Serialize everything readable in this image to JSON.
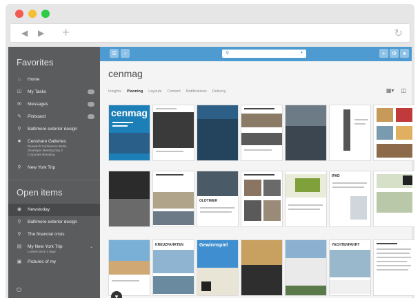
{
  "browser": {
    "back_icon": "back-arrow-icon",
    "forward_icon": "forward-arrow-icon",
    "new_tab_icon": "plus-icon",
    "reload_icon": "reload-icon"
  },
  "sidebar": {
    "favorites_title": "Favorites",
    "favorites": [
      {
        "label": "Home",
        "icon": "home-icon"
      },
      {
        "label": "My Tasks",
        "icon": "tasks-icon",
        "badge": true
      },
      {
        "label": "Messages",
        "icon": "messages-icon",
        "badge": true
      },
      {
        "label": "Pinboard",
        "icon": "pin-icon",
        "badge": true
      },
      {
        "label": "Baltimore exterior design",
        "icon": "search-icon"
      },
      {
        "label": "Censhare Galleries",
        "icon": "gallery-icon",
        "sub": [
          "Research Conference Berlin",
          "Developer Meeting Day 3",
          "Corporate Branding"
        ]
      },
      {
        "label": "New York Trip",
        "icon": "search-icon"
      }
    ],
    "open_title": "Open items",
    "open_items": [
      {
        "label": "Newstoday",
        "icon": "circle-icon"
      },
      {
        "label": "Baltimore exterior design",
        "icon": "search-icon"
      },
      {
        "label": "The financial crisis",
        "icon": "search-icon"
      },
      {
        "label": "My New York Trip",
        "icon": "doc-icon",
        "sub": [
          "Locked since 3 days"
        ]
      },
      {
        "label": "Pictures of my",
        "icon": "image-icon"
      }
    ],
    "footer_icon": "power-icon"
  },
  "main": {
    "title": "cenmag",
    "tabs": [
      "Insights",
      "Planning",
      "Layouts",
      "Content",
      "Notifications",
      "Delivery"
    ],
    "active_tab": "Planning",
    "accent": "#4d9bd1"
  },
  "thumbnail_captions": {
    "oldtimer": "OLDTIMER",
    "kreuzfahrten": "KREUZFAHRTEN",
    "gewinnspiel": "Gewinnspiel",
    "yachtenfahrt": "YACHTENFAHRT",
    "ipad": "IPAD",
    "cover_logo": "cenmag"
  }
}
